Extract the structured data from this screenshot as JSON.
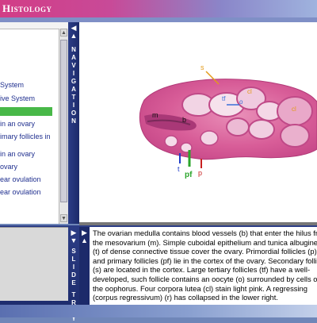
{
  "app": {
    "title": "Histology"
  },
  "nav_tree": {
    "items": [
      "System",
      "ive System",
      "",
      " in an ovary",
      "imary follicles in",
      "",
      "in an ovary",
      "ovary",
      "ear ovulation",
      "ear ovulation"
    ],
    "selected_index": 2
  },
  "navigation_bar": {
    "label": "NAVIGATION"
  },
  "slide_tray": {
    "label": "SLIDE TRAY"
  },
  "image_labels": {
    "s": "s",
    "tf": "tf",
    "o": "o",
    "cl": "cl",
    "m": "m",
    "b": "b",
    "t": "t",
    "pf": "pf",
    "p": "p"
  },
  "description": {
    "text": "The ovarian medulla contains blood vessels (b) that enter the hilus from the mesovarium (m). Simple cuboidal epithelium and tunica albuginea (t) of dense connective tissue cover the ovary. Primordial follicles (p) and primary follicles (pf) lie in the cortex of the ovary. Secondary follicles (s) are located in the cortex. Large tertiary follicles (tf) have a well-developed, such follicle contains an oocyte (o) surrounded by cells of the oophorus. Four corpora lutea (cl) stain light pink. A regressing (corpus regressivum) (r) has collapsed in the lower right."
  },
  "colors": {
    "accent_pink": "#d23d86",
    "nav_blue": "#1c2a6a",
    "highlight_green": "#48b848"
  }
}
